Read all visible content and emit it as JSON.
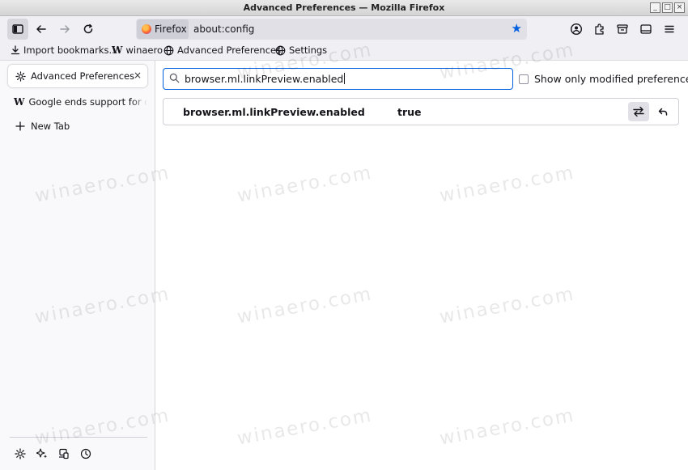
{
  "window": {
    "title": "Advanced Preferences — Mozilla Firefox",
    "controls": [
      "_",
      "□",
      "×"
    ]
  },
  "urlbar": {
    "identity_label": "Firefox",
    "url": "about:config"
  },
  "bookmarks": [
    {
      "label": "Import bookmarks...",
      "icon": "import-icon"
    },
    {
      "label": "winaero",
      "icon": "winaero-w-icon"
    },
    {
      "label": "Advanced Preferences",
      "icon": "globe-icon"
    },
    {
      "label": "Settings",
      "icon": "globe-icon"
    }
  ],
  "tabs": [
    {
      "label": "Advanced Preferences",
      "icon": "gear-icon",
      "selected": true,
      "close": "×"
    },
    {
      "label": "Google ends support for origin",
      "icon": "winaero-w-icon",
      "selected": false
    },
    {
      "label": "New Tab",
      "icon": "plus-icon"
    }
  ],
  "content": {
    "search_value": "browser.ml.linkPreview.enabled",
    "show_modified_label": "Show only modified preferences",
    "pref": {
      "name": "browser.ml.linkPreview.enabled",
      "value": "true"
    }
  },
  "watermark": "winaero.com",
  "colors": {
    "accent": "#0060df",
    "toolbar": "#f0f0f4",
    "sidebar": "#f9f9fb"
  }
}
